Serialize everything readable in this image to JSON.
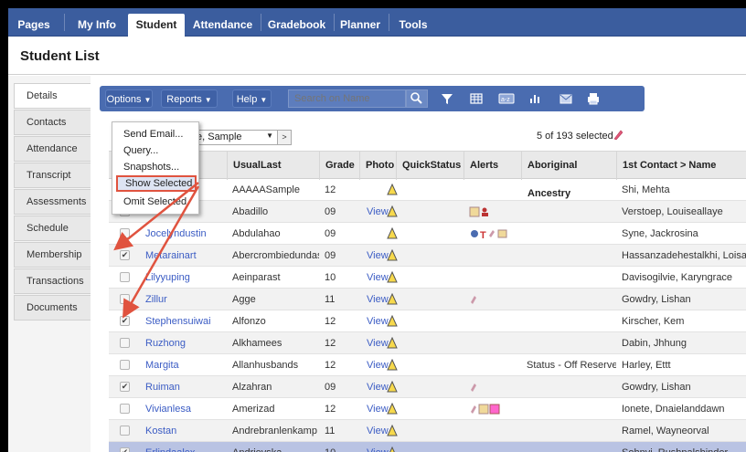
{
  "nav": {
    "tabs": [
      {
        "label": "Pages"
      },
      {
        "label": "My Info"
      },
      {
        "label": "Student"
      },
      {
        "label": "Attendance"
      },
      {
        "label": "Gradebook"
      },
      {
        "label": "Planner"
      },
      {
        "label": "Tools"
      }
    ],
    "active": "Student"
  },
  "page": {
    "title": "Student List"
  },
  "sidebar": {
    "items": [
      {
        "label": "Details"
      },
      {
        "label": "Contacts"
      },
      {
        "label": "Attendance"
      },
      {
        "label": "Transcript"
      },
      {
        "label": "Assessments"
      },
      {
        "label": "Schedule"
      },
      {
        "label": "Membership"
      },
      {
        "label": "Transactions"
      },
      {
        "label": "Documents"
      }
    ]
  },
  "toolbar": {
    "options_label": "Options",
    "reports_label": "Reports",
    "help_label": "Help",
    "search_placeholder": "Search on Name"
  },
  "filter": {
    "value": "e, Sample",
    "count_text": "5 of 193 selected"
  },
  "options_menu": {
    "items": [
      {
        "label": "Send Email..."
      },
      {
        "label": "Query..."
      },
      {
        "label": "Snapshots..."
      },
      {
        "label": "Show Selected",
        "highlighted": true
      },
      {
        "label": "Omit Selected"
      }
    ]
  },
  "table": {
    "columns": [
      "UsualLast",
      "Grade",
      "Photo",
      "QuickStatus",
      "Alerts",
      "Aboriginal Ancestry",
      "1st Contact > Name"
    ],
    "rows": [
      {
        "first": "",
        "last": "AAAAASample",
        "grade": "12",
        "photo": "",
        "status": "",
        "contact": "Shi, Mehta",
        "checked": false
      },
      {
        "first": "",
        "last": "Abadillo",
        "grade": "09",
        "photo": "View",
        "status": "",
        "contact": "Verstoep, Louiseallaye",
        "checked": false
      },
      {
        "first": "Jocelyndustin",
        "last": "Abdulahao",
        "grade": "09",
        "photo": "",
        "status": "",
        "contact": "Syne, Jackrosina",
        "checked": false
      },
      {
        "first": "Metarainart",
        "last": "Abercrombiedundas",
        "grade": "09",
        "photo": "View",
        "status": "",
        "contact": "Hassanzadehestalkhi, Loisart",
        "checked": true
      },
      {
        "first": "Lilyyuping",
        "last": "Aeinparast",
        "grade": "10",
        "photo": "View",
        "status": "",
        "contact": "Davisogilvie, Karyngrace",
        "checked": false
      },
      {
        "first": "Zillur",
        "last": "Agge",
        "grade": "11",
        "photo": "View",
        "status": "",
        "contact": "Gowdry, Lishan",
        "checked": false
      },
      {
        "first": "Stephensuiwai",
        "last": "Alfonzo",
        "grade": "12",
        "photo": "View",
        "status": "",
        "contact": "Kirscher, Kem",
        "checked": true
      },
      {
        "first": "Ruzhong",
        "last": "Alkhamees",
        "grade": "12",
        "photo": "View",
        "status": "",
        "contact": "Dabin, Jhhung",
        "checked": false
      },
      {
        "first": "Margita",
        "last": "Allanhusbands",
        "grade": "12",
        "photo": "View",
        "status": "Status - Off Reserve",
        "contact": "Harley, Ettt",
        "checked": false
      },
      {
        "first": "Ruiman",
        "last": "Alzahran",
        "grade": "09",
        "photo": "View",
        "status": "",
        "contact": "Gowdry, Lishan",
        "checked": true
      },
      {
        "first": "Vivianlesa",
        "last": "Amerizad",
        "grade": "12",
        "photo": "View",
        "status": "",
        "contact": "Ionete, Dnaielanddawn",
        "checked": false
      },
      {
        "first": "Kostan",
        "last": "Andrebranlenkamp",
        "grade": "11",
        "photo": "View",
        "status": "",
        "contact": "Ramel, Wayneorval",
        "checked": false
      },
      {
        "first": "Erlindaalex",
        "last": "Andrievska",
        "grade": "10",
        "photo": "View",
        "status": "",
        "contact": "Sohnvi, Rushpalshinder",
        "checked": true
      }
    ]
  },
  "colors": {
    "nav_bg": "#3b5d9e",
    "toolbar_bg": "#4a6cb0",
    "highlight_border": "#e0533f",
    "link": "#3b5cc4",
    "selected_row": "#b9c3e3"
  }
}
